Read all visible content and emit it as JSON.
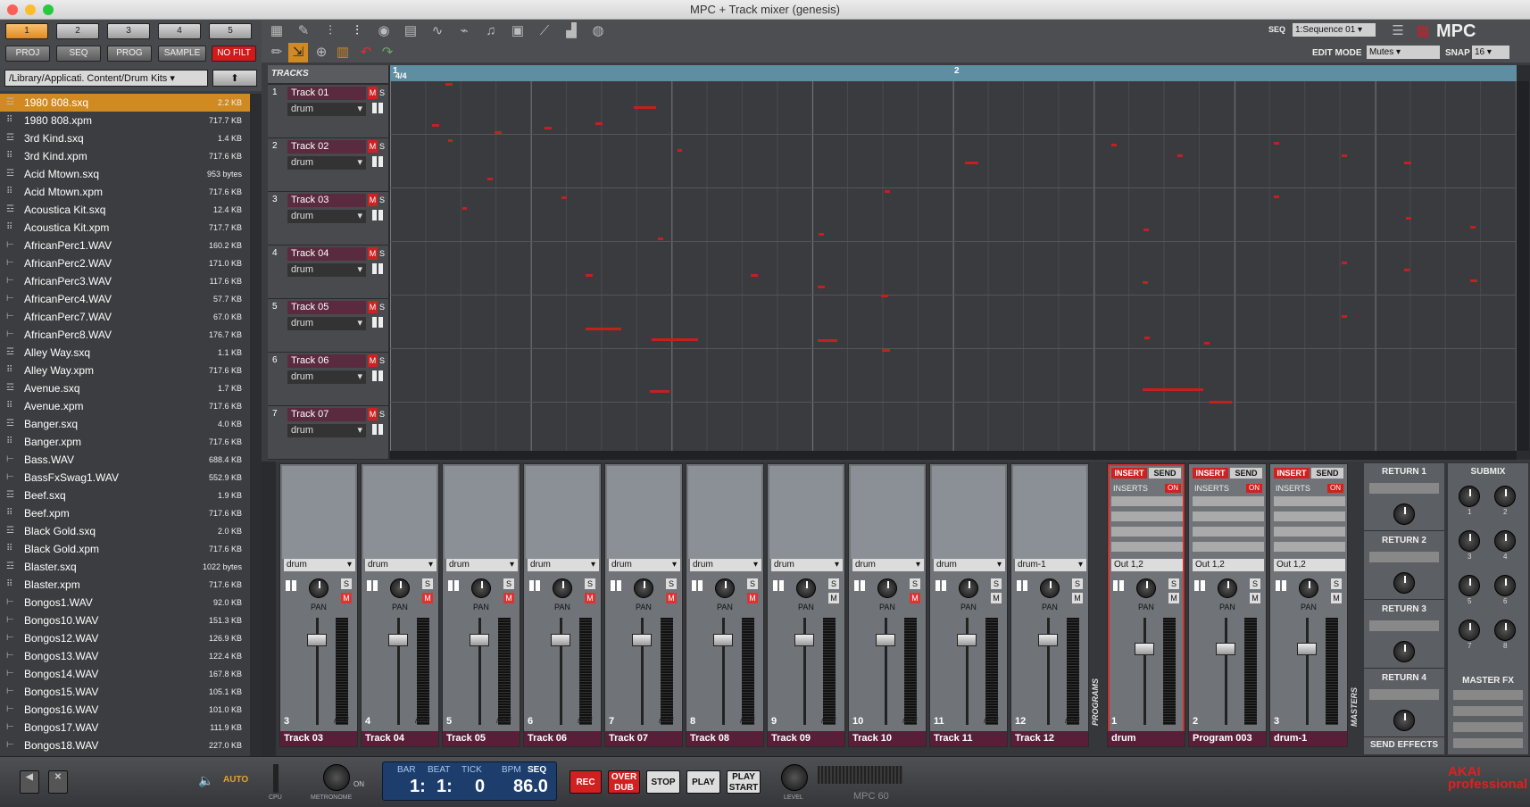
{
  "window": {
    "title": "MPC + Track mixer (genesis)"
  },
  "banks": [
    "1",
    "2",
    "3",
    "4",
    "5"
  ],
  "modes": [
    "PROJ",
    "SEQ",
    "PROG",
    "SAMPLE",
    "NO FILT"
  ],
  "browser": {
    "path": "/Library/Applicati. Content/Drum Kits",
    "up_icon": "up-arrow-icon",
    "files": [
      {
        "name": "1980 808.sxq",
        "size": "2.2 KB",
        "icon": "sequence-icon",
        "selected": true
      },
      {
        "name": "1980 808.xpm",
        "size": "717.7 KB",
        "icon": "program-icon"
      },
      {
        "name": "3rd Kind.sxq",
        "size": "1.4 KB",
        "icon": "sequence-icon"
      },
      {
        "name": "3rd Kind.xpm",
        "size": "717.6 KB",
        "icon": "program-icon"
      },
      {
        "name": "Acid Mtown.sxq",
        "size": "953 bytes",
        "icon": "sequence-icon"
      },
      {
        "name": "Acid Mtown.xpm",
        "size": "717.6 KB",
        "icon": "program-icon"
      },
      {
        "name": "Acoustica Kit.sxq",
        "size": "12.4 KB",
        "icon": "sequence-icon"
      },
      {
        "name": "Acoustica Kit.xpm",
        "size": "717.7 KB",
        "icon": "program-icon"
      },
      {
        "name": "AfricanPerc1.WAV",
        "size": "160.2 KB",
        "icon": "wave-icon"
      },
      {
        "name": "AfricanPerc2.WAV",
        "size": "171.0 KB",
        "icon": "wave-icon"
      },
      {
        "name": "AfricanPerc3.WAV",
        "size": "117.6 KB",
        "icon": "wave-icon"
      },
      {
        "name": "AfricanPerc4.WAV",
        "size": "57.7 KB",
        "icon": "wave-icon"
      },
      {
        "name": "AfricanPerc7.WAV",
        "size": "67.0 KB",
        "icon": "wave-icon"
      },
      {
        "name": "AfricanPerc8.WAV",
        "size": "176.7 KB",
        "icon": "wave-icon"
      },
      {
        "name": "Alley Way.sxq",
        "size": "1.1 KB",
        "icon": "sequence-icon"
      },
      {
        "name": "Alley Way.xpm",
        "size": "717.6 KB",
        "icon": "program-icon"
      },
      {
        "name": "Avenue.sxq",
        "size": "1.7 KB",
        "icon": "sequence-icon"
      },
      {
        "name": "Avenue.xpm",
        "size": "717.6 KB",
        "icon": "program-icon"
      },
      {
        "name": "Banger.sxq",
        "size": "4.0 KB",
        "icon": "sequence-icon"
      },
      {
        "name": "Banger.xpm",
        "size": "717.6 KB",
        "icon": "program-icon"
      },
      {
        "name": "Bass.WAV",
        "size": "688.4 KB",
        "icon": "wave-icon"
      },
      {
        "name": "BassFxSwag1.WAV",
        "size": "552.9 KB",
        "icon": "wave-icon"
      },
      {
        "name": "Beef.sxq",
        "size": "1.9 KB",
        "icon": "sequence-icon"
      },
      {
        "name": "Beef.xpm",
        "size": "717.6 KB",
        "icon": "program-icon"
      },
      {
        "name": "Black Gold.sxq",
        "size": "2.0 KB",
        "icon": "sequence-icon"
      },
      {
        "name": "Black Gold.xpm",
        "size": "717.6 KB",
        "icon": "program-icon"
      },
      {
        "name": "Blaster.sxq",
        "size": "1022 bytes",
        "icon": "sequence-icon"
      },
      {
        "name": "Blaster.xpm",
        "size": "717.6 KB",
        "icon": "program-icon"
      },
      {
        "name": "Bongos1.WAV",
        "size": "92.0 KB",
        "icon": "wave-icon"
      },
      {
        "name": "Bongos10.WAV",
        "size": "151.3 KB",
        "icon": "wave-icon"
      },
      {
        "name": "Bongos12.WAV",
        "size": "126.9 KB",
        "icon": "wave-icon"
      },
      {
        "name": "Bongos13.WAV",
        "size": "122.4 KB",
        "icon": "wave-icon"
      },
      {
        "name": "Bongos14.WAV",
        "size": "167.8 KB",
        "icon": "wave-icon"
      },
      {
        "name": "Bongos15.WAV",
        "size": "105.1 KB",
        "icon": "wave-icon"
      },
      {
        "name": "Bongos16.WAV",
        "size": "101.0 KB",
        "icon": "wave-icon"
      },
      {
        "name": "Bongos17.WAV",
        "size": "111.9 KB",
        "icon": "wave-icon"
      },
      {
        "name": "Bongos18.WAV",
        "size": "227.0 KB",
        "icon": "wave-icon"
      }
    ]
  },
  "toolbar": {
    "seq_label": "SEQ",
    "seq_value": "1:Sequence 01",
    "edit_mode_label": "EDIT MODE",
    "edit_mode_value": "Mutes",
    "snap_label": "SNAP",
    "snap_value": "16",
    "logo": "MPC"
  },
  "tracks_header": "TRACKS",
  "ruler": {
    "time_sig": "4/4",
    "bars": [
      "1",
      "2"
    ]
  },
  "tracks": [
    {
      "num": "1",
      "name": "Track 01",
      "program": "drum"
    },
    {
      "num": "2",
      "name": "Track 02",
      "program": "drum"
    },
    {
      "num": "3",
      "name": "Track 03",
      "program": "drum"
    },
    {
      "num": "4",
      "name": "Track 04",
      "program": "drum"
    },
    {
      "num": "5",
      "name": "Track 05",
      "program": "drum"
    },
    {
      "num": "6",
      "name": "Track 06",
      "program": "drum"
    },
    {
      "num": "7",
      "name": "Track 07",
      "program": "drum"
    }
  ],
  "track_btn": {
    "mute": "M",
    "solo": "S"
  },
  "channels": [
    {
      "num": "3",
      "name": "Track 03",
      "program": "drum",
      "muted": true
    },
    {
      "num": "4",
      "name": "Track 04",
      "program": "drum",
      "muted": true
    },
    {
      "num": "5",
      "name": "Track 05",
      "program": "drum",
      "muted": true
    },
    {
      "num": "6",
      "name": "Track 06",
      "program": "drum",
      "muted": true
    },
    {
      "num": "7",
      "name": "Track 07",
      "program": "drum",
      "muted": true
    },
    {
      "num": "8",
      "name": "Track 08",
      "program": "drum",
      "muted": true
    },
    {
      "num": "9",
      "name": "Track 09",
      "program": "drum",
      "muted": false
    },
    {
      "num": "10",
      "name": "Track 10",
      "program": "drum",
      "muted": true
    },
    {
      "num": "11",
      "name": "Track 11",
      "program": "drum",
      "muted": false
    },
    {
      "num": "12",
      "name": "Track 12",
      "program": "drum-1",
      "muted": false
    }
  ],
  "channel_labels": {
    "pan": "PAN",
    "midi": "midi",
    "solo": "S",
    "mute": "M"
  },
  "programs_label": "PROGRAMS",
  "program_channels": [
    {
      "num": "1",
      "name": "drum",
      "out": "Out 1,2"
    },
    {
      "num": "2",
      "name": "Program 003",
      "out": "Out 1,2"
    },
    {
      "num": "3",
      "name": "drum-1",
      "out": "Out 1,2"
    }
  ],
  "program_labels": {
    "insert": "INSERT",
    "send": "SEND",
    "inserts": "INSERTS",
    "on": "ON"
  },
  "masters_label": "MASTERS",
  "returns": [
    "RETURN 1",
    "RETURN 2",
    "RETURN 3",
    "RETURN 4"
  ],
  "send_effects": "SEND EFFECTS",
  "submix": {
    "title": "SUBMIX",
    "knobs": [
      "1",
      "2",
      "3",
      "4",
      "5",
      "6",
      "7",
      "8"
    ],
    "master_fx": "MASTER FX"
  },
  "transport": {
    "auto": "AUTO",
    "cpu": "CPU",
    "metronome": "METRONOME",
    "metronome_state": "ON",
    "bar_label": "BAR",
    "beat_label": "BEAT",
    "tick_label": "TICK",
    "bpm_label": "BPM",
    "seq_label": "SEQ",
    "bar": "1:",
    "beat": "1:",
    "tick": "0",
    "bpm": "86.0",
    "rec": "REC",
    "overdub": "OVER DUB",
    "stop": "STOP",
    "play": "PLAY",
    "play_start": "PLAY START",
    "level": "LEVEL",
    "device": "MPC 60",
    "brand": "AKAI professional"
  },
  "colors": {
    "accent": "#d18a22",
    "record": "#d02020",
    "track_name_bg": "#5a1f38",
    "lcd": "#1d3d6d",
    "ruler": "#5f8ea2"
  }
}
